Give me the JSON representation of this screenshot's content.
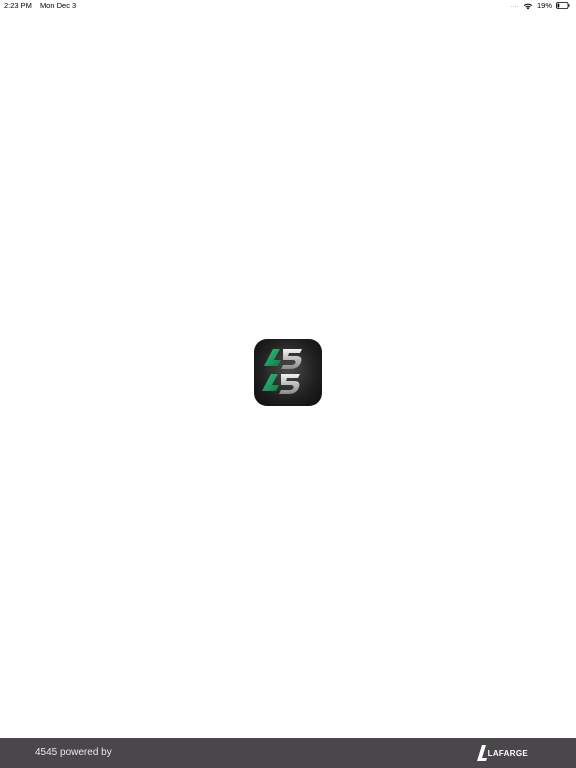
{
  "status_bar": {
    "time": "2:23 PM",
    "date": "Mon Dec 3",
    "signal": "....",
    "battery_percent": "19%",
    "battery_level": 0.19,
    "icons": [
      "wifi-icon",
      "battery-icon"
    ]
  },
  "app_icon": {
    "icon": "4545-app-logo",
    "accent_color": "#1aa061"
  },
  "footer": {
    "powered_by_text": "4545 powered by",
    "logo_text": "LAFARGE",
    "background_color": "#4a474a"
  }
}
